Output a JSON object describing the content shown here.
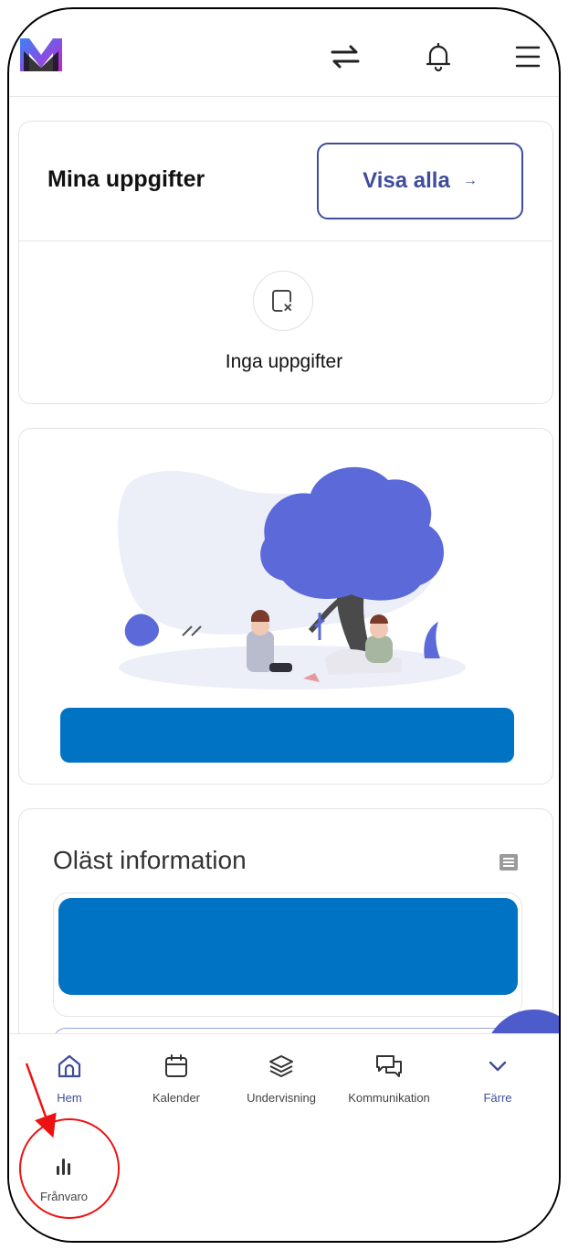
{
  "header": {
    "logo": "M-logo",
    "icons": [
      "swap-icon",
      "bell-icon",
      "menu-icon"
    ]
  },
  "tasks_card": {
    "title": "Mina uppgifter",
    "view_all_label": "Visa alla",
    "view_all_arrow": "→",
    "empty_text": "Inga uppgifter"
  },
  "info_card": {
    "title": "Oläst information"
  },
  "bottom_nav": {
    "items": [
      {
        "label": "Hem",
        "icon": "home-icon",
        "active": true
      },
      {
        "label": "Kalender",
        "icon": "calendar-icon"
      },
      {
        "label": "Undervisning",
        "icon": "layers-icon"
      },
      {
        "label": "Kommunikation",
        "icon": "chat-icon"
      },
      {
        "label": "Färre",
        "icon": "chevron-down-icon",
        "active": true
      },
      {
        "label": "Frånvaro",
        "icon": "bar-chart-icon"
      }
    ]
  },
  "colors": {
    "accent": "#3f4c9d",
    "blue_bar": "#0073c4",
    "tree": "#5b6ad8",
    "annotation": "#e11111"
  }
}
